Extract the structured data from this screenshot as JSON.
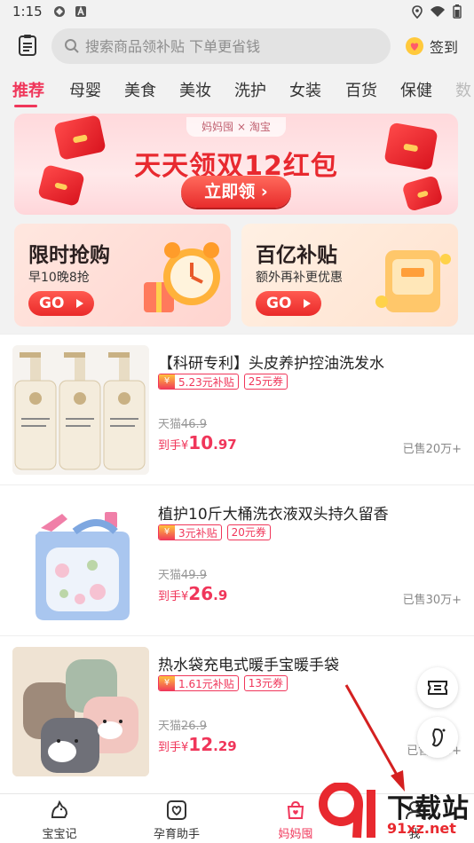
{
  "status_bar": {
    "time": "1:15"
  },
  "header": {
    "search_placeholder": "搜索商品领补贴 下单更省钱",
    "signin_label": "签到"
  },
  "tabs": [
    "推荐",
    "母婴",
    "美食",
    "美妆",
    "洗护",
    "女装",
    "百货",
    "保健",
    "数"
  ],
  "active_tab": "推荐",
  "banner": {
    "tag": "妈妈囤 × 淘宝",
    "title": "天天领双12红包",
    "cta": "立即领"
  },
  "promos": [
    {
      "title": "限时抢购",
      "subtitle": "早10晚8抢",
      "cta": "GO"
    },
    {
      "title": "百亿补贴",
      "subtitle": "额外再补更优惠",
      "cta": "GO"
    }
  ],
  "products": [
    {
      "name": "【科研专利】头皮养护控油洗发水",
      "subsidy": "5.23元补贴",
      "coupon": "25元券",
      "orig_label": "天猫",
      "orig_price": "46.9",
      "price_label": "到手",
      "price_symbol": "¥",
      "price_int": "10",
      "price_dec": ".97",
      "sold": "已售20万+"
    },
    {
      "name": "植护10斤大桶洗衣液双头持久留香",
      "subsidy": "3元补贴",
      "coupon": "20元券",
      "orig_label": "天猫",
      "orig_price": "49.9",
      "price_label": "到手",
      "price_symbol": "¥",
      "price_int": "26",
      "price_dec": ".9",
      "sold": "已售30万+"
    },
    {
      "name": "热水袋充电式暖手宝暖手袋",
      "subsidy": "1.61元补贴",
      "coupon": "13元券",
      "orig_label": "天猫",
      "orig_price": "26.9",
      "price_label": "到手",
      "price_symbol": "¥",
      "price_int": "12",
      "price_dec": ".29",
      "sold": "已售400+"
    }
  ],
  "bottom_nav": [
    {
      "label": "宝宝记",
      "icon": "dino-icon"
    },
    {
      "label": "孕育助手",
      "icon": "heart-box-icon"
    },
    {
      "label": "妈妈囤",
      "icon": "bag-icon",
      "active": true
    },
    {
      "label": "我",
      "icon": "user-icon"
    }
  ],
  "watermark": {
    "line1": "下载站",
    "line2": "91xz.net"
  },
  "colors": {
    "accent": "#f0365a",
    "background": "#f2f2f2"
  }
}
